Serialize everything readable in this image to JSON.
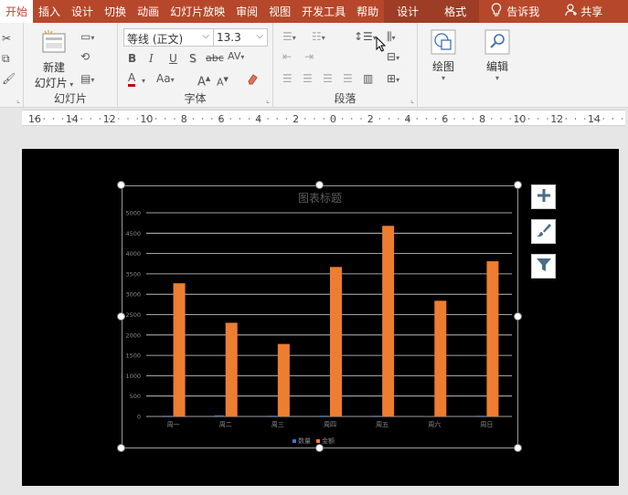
{
  "tabs": [
    {
      "label": "开始",
      "active": true
    },
    {
      "label": "插入"
    },
    {
      "label": "设计"
    },
    {
      "label": "切换"
    },
    {
      "label": "动画"
    },
    {
      "label": "幻灯片放映"
    },
    {
      "label": "审阅"
    },
    {
      "label": "视图"
    },
    {
      "label": "开发工具"
    },
    {
      "label": "帮助"
    }
  ],
  "context_tabs": [
    {
      "label": "设计"
    },
    {
      "label": "格式"
    }
  ],
  "tell_me": "告诉我",
  "share": "共享",
  "ribbon": {
    "slides": {
      "new_slide_line1": "新建",
      "new_slide_line2": "幻灯片",
      "group_label": "幻灯片"
    },
    "font": {
      "font_name": "等线 (正文)",
      "font_size": "13.3",
      "group_label": "字体",
      "bold": "B",
      "italic": "I",
      "underline": "U",
      "shadow": "S",
      "strike": "abc",
      "spacing": "AV",
      "font_color": "A",
      "change_case": "Aa",
      "grow": "A",
      "shrink": "A"
    },
    "paragraph": {
      "group_label": "段落"
    },
    "drawing": {
      "label": "绘图"
    },
    "editing": {
      "label": "编辑"
    }
  },
  "ruler": {
    "labels": [
      "16",
      "14",
      "12",
      "10",
      "8",
      "6",
      "4",
      "2",
      "0",
      "2",
      "4",
      "6",
      "8",
      "10",
      "12",
      "14",
      "16"
    ]
  },
  "colors": {
    "accent": "#b7472a",
    "bar_orange": "#ed7d31",
    "bar_blue": "#4472c4"
  },
  "chart_data": {
    "type": "bar",
    "title": "图表标题",
    "categories": [
      "周一",
      "周二",
      "周三",
      "周四",
      "周五",
      "周六",
      "周日"
    ],
    "series": [
      {
        "name": "数量",
        "values": [
          20,
          30,
          20,
          20,
          20,
          5,
          20
        ]
      },
      {
        "name": "金额",
        "values": [
          3270,
          2300,
          1780,
          3670,
          4680,
          2840,
          3810
        ]
      }
    ],
    "yticks": [
      "0",
      "500",
      "1000",
      "1500",
      "2000",
      "2500",
      "3000",
      "3500",
      "4000",
      "4500",
      "5000"
    ],
    "ylim": [
      0,
      5000
    ],
    "grid": true,
    "legend_position": "bottom"
  }
}
